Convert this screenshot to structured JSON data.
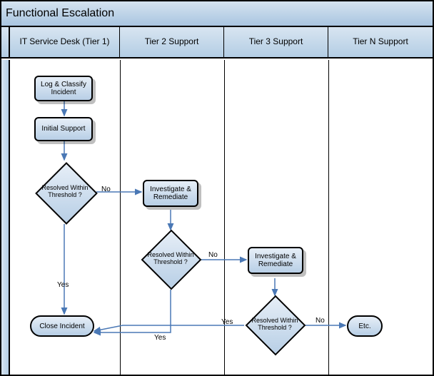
{
  "title": "Functional Escalation",
  "lanes": {
    "tier1": "IT Service Desk (Tier 1)",
    "tier2": "Tier 2 Support",
    "tier3": "Tier 3 Support",
    "tierN": "Tier N Support"
  },
  "nodes": {
    "log_classify": "Log & Classify Incident",
    "initial_support": "Initial Support",
    "resolved1": "Resolved Within Threshold ?",
    "investigate2": "Investigate & Remediate",
    "resolved2": "Resolved Within Threshold ?",
    "investigate3": "Investigate & Remediate",
    "resolved3": "Resolved Within Threshold ?",
    "close": "Close Incident",
    "etc": "Etc."
  },
  "edges": {
    "yes": "Yes",
    "no": "No"
  },
  "chart_data": {
    "type": "swimlane-flowchart",
    "title": "Functional Escalation",
    "lanes": [
      "IT Service Desk (Tier 1)",
      "Tier 2 Support",
      "Tier 3 Support",
      "Tier N Support"
    ],
    "nodes": [
      {
        "id": "log_classify",
        "lane": 0,
        "type": "process",
        "label": "Log & Classify Incident"
      },
      {
        "id": "initial_support",
        "lane": 0,
        "type": "process",
        "label": "Initial Support"
      },
      {
        "id": "resolved1",
        "lane": 0,
        "type": "decision",
        "label": "Resolved Within Threshold ?"
      },
      {
        "id": "close",
        "lane": 0,
        "type": "terminator",
        "label": "Close Incident"
      },
      {
        "id": "investigate2",
        "lane": 1,
        "type": "process",
        "label": "Investigate & Remediate"
      },
      {
        "id": "resolved2",
        "lane": 1,
        "type": "decision",
        "label": "Resolved Within Threshold ?"
      },
      {
        "id": "investigate3",
        "lane": 2,
        "type": "process",
        "label": "Investigate & Remediate"
      },
      {
        "id": "resolved3",
        "lane": 2,
        "type": "decision",
        "label": "Resolved Within Threshold ?"
      },
      {
        "id": "etc",
        "lane": 3,
        "type": "terminator",
        "label": "Etc."
      }
    ],
    "edges": [
      {
        "from": "log_classify",
        "to": "initial_support",
        "label": ""
      },
      {
        "from": "initial_support",
        "to": "resolved1",
        "label": ""
      },
      {
        "from": "resolved1",
        "to": "close",
        "label": "Yes"
      },
      {
        "from": "resolved1",
        "to": "investigate2",
        "label": "No"
      },
      {
        "from": "investigate2",
        "to": "resolved2",
        "label": ""
      },
      {
        "from": "resolved2",
        "to": "close",
        "label": "Yes"
      },
      {
        "from": "resolved2",
        "to": "investigate3",
        "label": "No"
      },
      {
        "from": "investigate3",
        "to": "resolved3",
        "label": ""
      },
      {
        "from": "resolved3",
        "to": "close",
        "label": "Yes"
      },
      {
        "from": "resolved3",
        "to": "etc",
        "label": "No"
      }
    ]
  }
}
